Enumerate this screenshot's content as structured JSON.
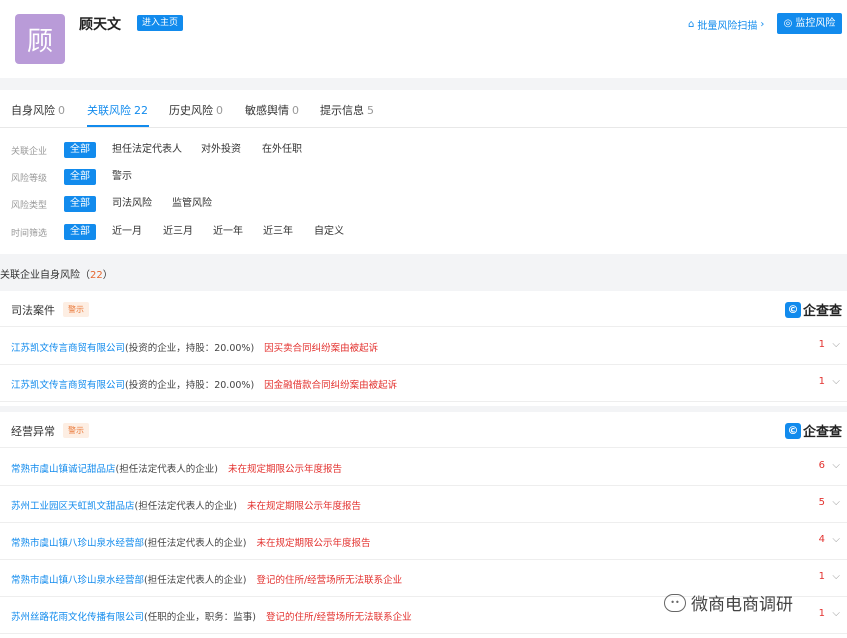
{
  "header": {
    "avatar_char": "顾",
    "name": "顾天文",
    "enter_home_label": "进入主页",
    "batch_scan_label": "批量风险扫描",
    "monitor_label": "监控风险"
  },
  "tabs": [
    {
      "label": "自身风险",
      "count": "0",
      "active": false
    },
    {
      "label": "关联风险",
      "count": "22",
      "active": true
    },
    {
      "label": "历史风险",
      "count": "0",
      "active": false
    },
    {
      "label": "敏感舆情",
      "count": "0",
      "active": false
    },
    {
      "label": "提示信息",
      "count": "5",
      "active": false
    }
  ],
  "filters": {
    "related": {
      "label": "关联企业",
      "options": [
        "全部",
        "担任法定代表人",
        "对外投资",
        "在外任职"
      ]
    },
    "level": {
      "label": "风险等级",
      "options": [
        "全部",
        "警示"
      ]
    },
    "type": {
      "label": "风险类型",
      "options": [
        "全部",
        "司法风险",
        "监管风险"
      ]
    },
    "time": {
      "label": "时间筛选",
      "options": [
        "全部",
        "近一月",
        "近三月",
        "近一年",
        "近三年",
        "自定义"
      ]
    }
  },
  "section": {
    "title": "关联企业自身风险（",
    "count": "22",
    "close": "）"
  },
  "judicial": {
    "title": "司法案件",
    "badge": "警示",
    "brand": "企查查",
    "rows": [
      {
        "company": "江苏凯文传言商贸有限公司",
        "relation": "(投资的企业，持股：20.00%)",
        "risk": "因买卖合同纠纷案由被起诉",
        "count": "1"
      },
      {
        "company": "江苏凯文传言商贸有限公司",
        "relation": "(投资的企业，持股：20.00%)",
        "risk": "因金融借款合同纠纷案由被起诉",
        "count": "1"
      }
    ]
  },
  "abnormal": {
    "title": "经营异常",
    "badge": "警示",
    "brand": "企查查",
    "rows": [
      {
        "company": "常熟市虞山镇诚记甜品店",
        "relation": "(担任法定代表人的企业)",
        "risk": "未在规定期限公示年度报告",
        "count": "6"
      },
      {
        "company": "苏州工业园区天虹凯文甜品店",
        "relation": "(担任法定代表人的企业)",
        "risk": "未在规定期限公示年度报告",
        "count": "5"
      },
      {
        "company": "常熟市虞山镇八珍山泉水经营部",
        "relation": "(担任法定代表人的企业)",
        "risk": "未在规定期限公示年度报告",
        "count": "4"
      },
      {
        "company": "常熟市虞山镇八珍山泉水经营部",
        "relation": "(担任法定代表人的企业)",
        "risk": "登记的住所/经营场所无法联系企业",
        "count": "1"
      },
      {
        "company": "苏州丝路花雨文化传播有限公司",
        "relation": "(任职的企业，职务：监事)",
        "risk": "登记的住所/经营场所无法联系企业",
        "count": "1"
      }
    ]
  },
  "watermark": "微商电商调研"
}
